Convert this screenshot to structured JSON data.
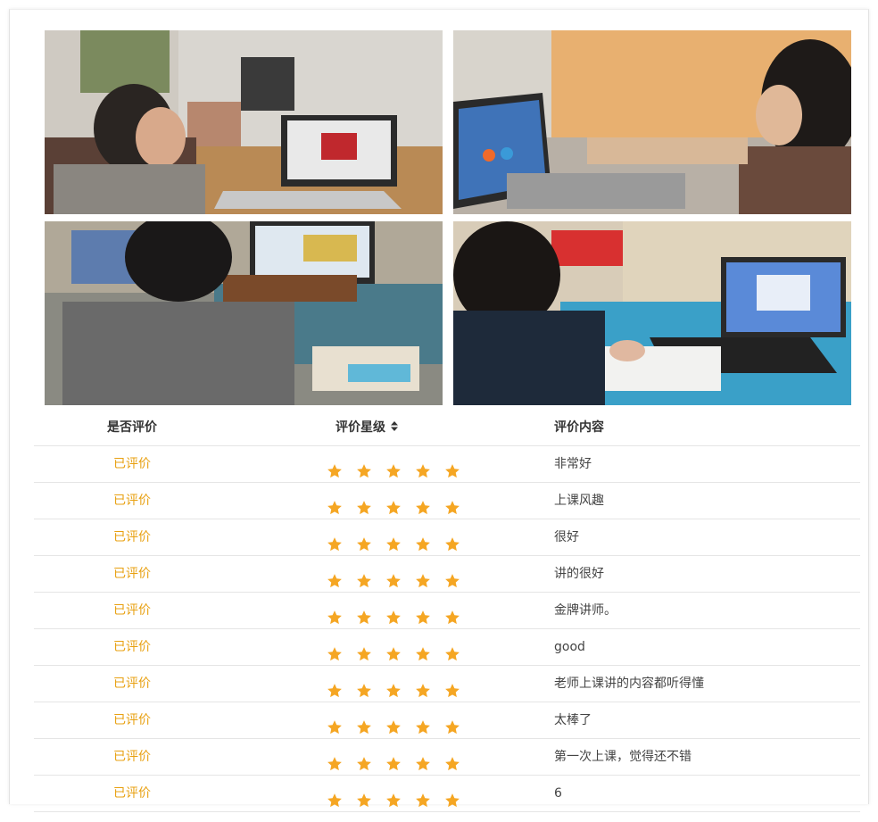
{
  "table": {
    "headers": {
      "status": "是否评价",
      "rating": "评价星级",
      "comment": "评价内容"
    },
    "sort_icon": "sort-icon",
    "star_color": "#f5a623",
    "status_color": "#e8a010",
    "rows": [
      {
        "status": "已评价",
        "stars": 5,
        "comment": "非常好"
      },
      {
        "status": "已评价",
        "stars": 5,
        "comment": "上课风趣"
      },
      {
        "status": "已评价",
        "stars": 5,
        "comment": "很好"
      },
      {
        "status": "已评价",
        "stars": 5,
        "comment": "讲的很好"
      },
      {
        "status": "已评价",
        "stars": 5,
        "comment": "金牌讲师。"
      },
      {
        "status": "已评价",
        "stars": 5,
        "comment": "good"
      },
      {
        "status": "已评价",
        "stars": 5,
        "comment": "老师上课讲的内容都听得懂"
      },
      {
        "status": "已评价",
        "stars": 5,
        "comment": "太棒了"
      },
      {
        "status": "已评价",
        "stars": 5,
        "comment": "第一次上课，觉得还不错"
      },
      {
        "status": "已评价",
        "stars": 5,
        "comment": "6"
      }
    ]
  }
}
